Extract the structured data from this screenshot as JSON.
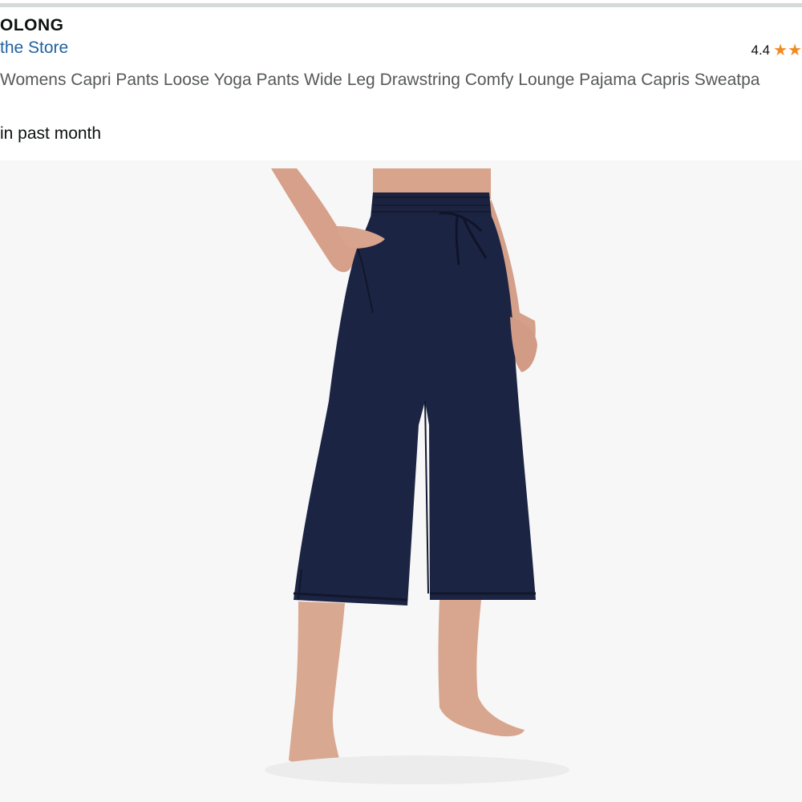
{
  "header": {
    "brand": "OLONG",
    "store_link": "the Store",
    "rating": "4.4",
    "title": "Womens Capri Pants Loose Yoga Pants Wide Leg Drawstring Comfy Lounge Pajama Capris Sweatpa",
    "bought_text": "in past month"
  },
  "icons": {
    "star": "star-icon"
  },
  "colors": {
    "link": "#2162a1",
    "star": "#f08a24",
    "pants": "#1c2444",
    "image_bg": "#f7f7f7"
  }
}
